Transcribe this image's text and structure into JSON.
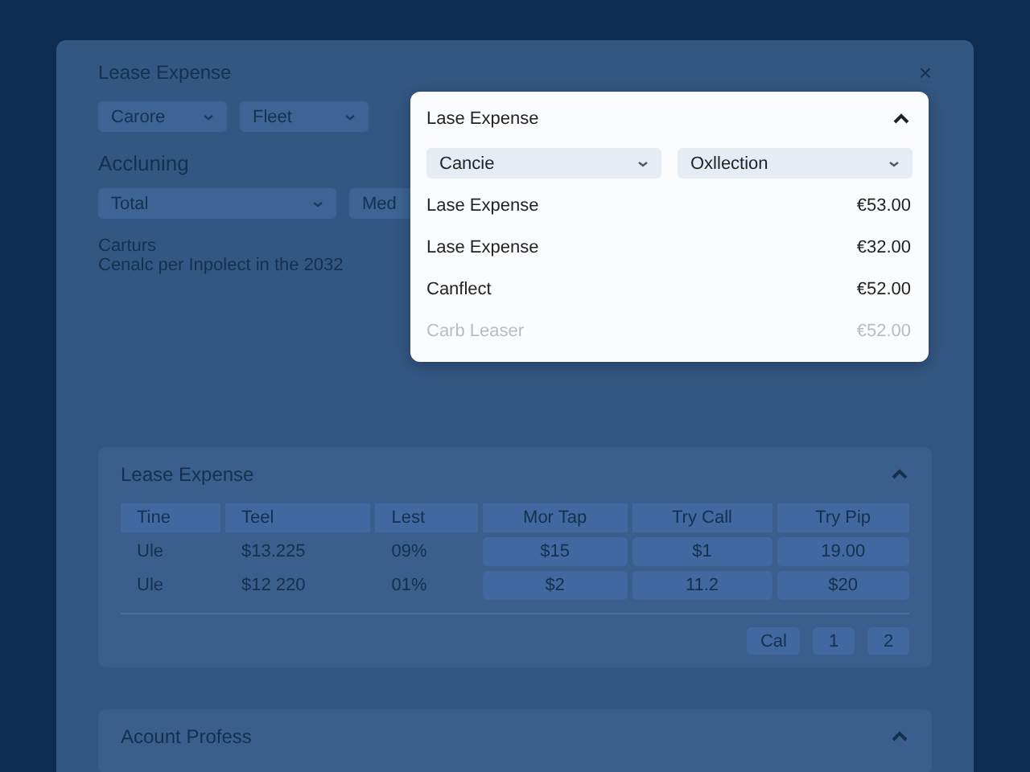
{
  "dialog": {
    "title": "Lease Expense",
    "close": "×",
    "filters": [
      {
        "value": "Carore"
      },
      {
        "value": "Fleet"
      }
    ],
    "section_label": "Accluning",
    "selects": [
      {
        "value": "Total"
      },
      {
        "value": "Med"
      }
    ],
    "note_title": "Carturs",
    "note_text": "Cenalc per Inpolect in the 2032"
  },
  "dropdown": {
    "title": "Lase Expense",
    "expanded": true,
    "selects": [
      {
        "value": "Cancie"
      },
      {
        "value": "Oxllection"
      }
    ],
    "items": [
      {
        "label": "Lase Expense",
        "amount": "€53.00",
        "disabled": false
      },
      {
        "label": "Lase Expense",
        "amount": "€32.00",
        "disabled": false
      },
      {
        "label": "Canflect",
        "amount": "€52.00",
        "disabled": false
      },
      {
        "label": "Carb Leaser",
        "amount": "€52.00",
        "disabled": true
      }
    ]
  },
  "cards": [
    {
      "title": "Lease Expense",
      "expanded": true,
      "table": {
        "columns": [
          {
            "label": "Tine",
            "kind": "text"
          },
          {
            "label": "Teel",
            "kind": "text"
          },
          {
            "label": "Lest",
            "kind": "text"
          },
          {
            "label": "Mor Tap",
            "kind": "boxed"
          },
          {
            "label": "Try Call",
            "kind": "boxed"
          },
          {
            "label": "Try Pip",
            "kind": "boxed"
          }
        ],
        "rows": [
          [
            "Ule",
            "$13.225",
            "09%",
            "$15",
            "$1",
            "19.00"
          ],
          [
            "Ule",
            "$12 220",
            "01%",
            "$2",
            "11.2",
            "$20"
          ]
        ]
      },
      "pagination": [
        "Cal",
        "1",
        "2"
      ]
    },
    {
      "title": "Acount Profess",
      "expanded": true
    }
  ]
}
